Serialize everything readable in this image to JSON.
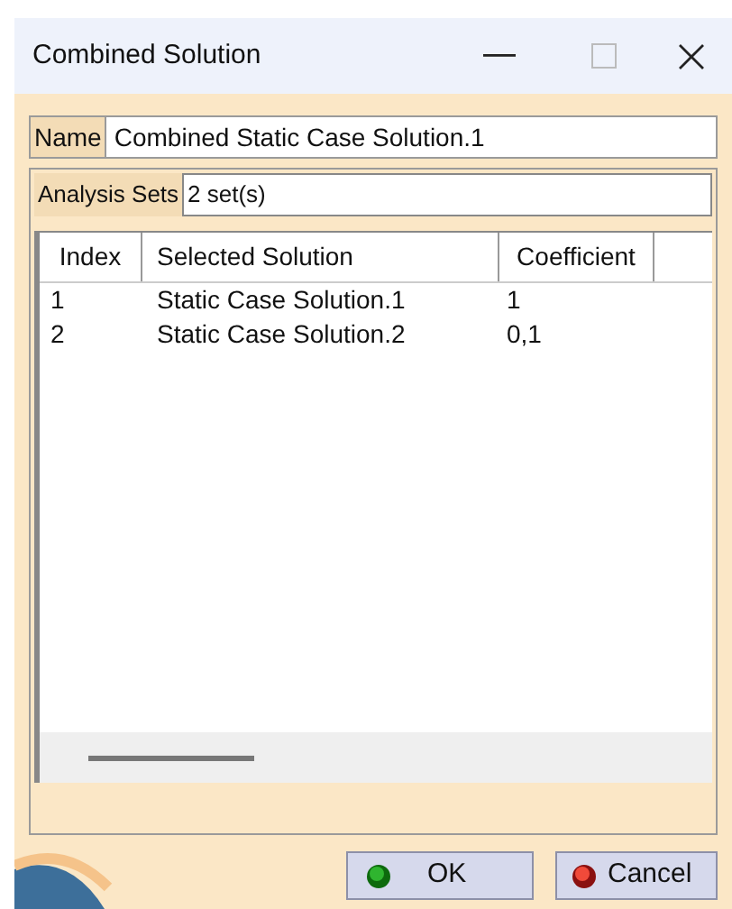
{
  "window": {
    "title": "Combined Solution"
  },
  "name_field": {
    "label": "Name",
    "value": "Combined Static Case Solution.1"
  },
  "analysis_sets": {
    "label": "Analysis Sets",
    "value": "2 set(s)"
  },
  "table": {
    "columns": [
      "Index",
      "Selected Solution",
      "Coefficient"
    ],
    "rows": [
      [
        "1",
        "Static Case Solution.1",
        "1"
      ],
      [
        "2",
        "Static Case Solution.2",
        "0,1"
      ]
    ]
  },
  "buttons": [
    {
      "label": "OK",
      "kind": "ok"
    },
    {
      "label": "Cancel",
      "kind": "cancel"
    }
  ]
}
